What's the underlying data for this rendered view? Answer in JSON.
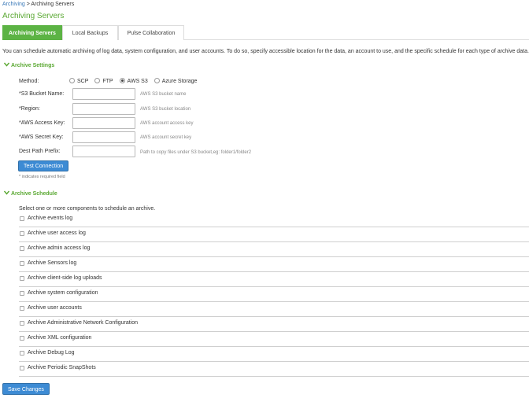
{
  "breadcrumb": {
    "link": "Archiving",
    "separator": ">",
    "current": "Archiving Servers"
  },
  "page": {
    "title": "Archiving Servers"
  },
  "tabs": [
    {
      "label": "Archiving Servers",
      "active": true
    },
    {
      "label": "Local Backups",
      "active": false
    },
    {
      "label": "Pulse Collaboration",
      "active": false
    }
  ],
  "intro": "You can schedule automatic archiving of log data, system configuration, and user accounts. To do so, specify accessible location for the data, an account to use, and the specific schedule for each type of archive data.",
  "archive_settings": {
    "heading": "Archive Settings",
    "method_label": "Method:",
    "methods": [
      {
        "label": "SCP",
        "selected": false
      },
      {
        "label": "FTP",
        "selected": false
      },
      {
        "label": "AWS S3",
        "selected": true
      },
      {
        "label": "Azure Storage",
        "selected": false
      }
    ],
    "fields": [
      {
        "label": "*S3 Bucket Name:",
        "value": "",
        "hint": "AWS S3 bucket name"
      },
      {
        "label": "*Region:",
        "value": "",
        "hint": "AWS S3 bucket location"
      },
      {
        "label": "*AWS Access Key:",
        "value": "",
        "hint": "AWS account access key"
      },
      {
        "label": "*AWS Secret Key:",
        "value": "",
        "hint": "AWS account secret key"
      },
      {
        "label": "Dest Path Prefix:",
        "value": "",
        "hint": "Path to copy files under S3 bucket,eg: folder1/folder2"
      }
    ],
    "test_button": "Test Connection",
    "required_note": "* indicates required field"
  },
  "archive_schedule": {
    "heading": "Archive Schedule",
    "prompt": "Select one or more components to schedule an archive.",
    "components": [
      "Archive events log",
      "Archive user access log",
      "Archive admin access log",
      "Archive Sensors log",
      "Archive client-side log uploads",
      "Archive system configuration",
      "Archive user accounts",
      "Archive Administrative Network Configuration",
      "Archive XML configuration",
      "Archive Debug Log",
      "Archive Periodic SnapShots"
    ]
  },
  "save_button": "Save Changes",
  "colors": {
    "accent_green": "#5cb344",
    "button_blue": "#3d8bd4",
    "link_blue": "#3a79b8"
  }
}
